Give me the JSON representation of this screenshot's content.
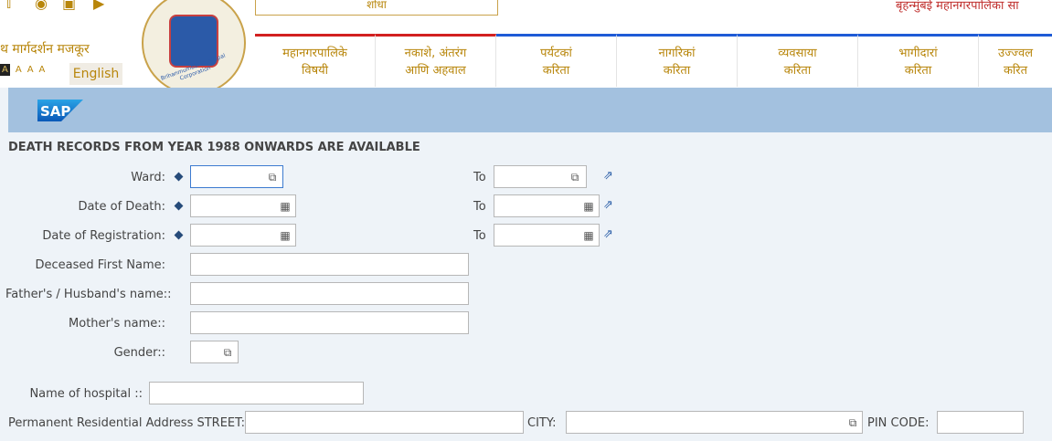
{
  "header": {
    "nav_links": "थ मार्गदर्शन   मजकूर",
    "font_sizes": [
      "A",
      "A",
      "A",
      "A"
    ],
    "english_label": "English",
    "search_label": "शोधा",
    "corp_name": "बृहन्मुंबई महानगरपालिका सा",
    "logo_text": "Brihanmumbai Municipal Corporation",
    "menu": [
      {
        "line1": "महानगरपालिके",
        "line2": "विषयी"
      },
      {
        "line1": "नकाशे, अंतरंग",
        "line2": "आणि अहवाल"
      },
      {
        "line1": "पर्यटकां",
        "line2": "करिता"
      },
      {
        "line1": "नागरिकां",
        "line2": "करिता"
      },
      {
        "line1": "व्यवसाया",
        "line2": "करिता"
      },
      {
        "line1": "भागीदारां",
        "line2": "करिता"
      },
      {
        "line1": "उज्ज्वल",
        "line2": "करित"
      }
    ]
  },
  "sap": {
    "logo_text": "SAP"
  },
  "form": {
    "title": "DEATH RECORDS FROM YEAR 1988 ONWARDS ARE AVAILABLE",
    "to_label": "To",
    "ward_label": "Ward:",
    "date_of_death_label": "Date of Death:",
    "date_of_registration_label": "Date of Registration:",
    "deceased_first_name_label": "Deceased First Name:",
    "father_husband_label": "Father's / Husband's name::",
    "mother_label": "Mother's name::",
    "gender_label": "Gender::",
    "hospital_label": "Name of hospital ::",
    "street_label": "Permanent Residential Address STREET:",
    "city_label": "CITY:",
    "pin_label": "PIN CODE:"
  },
  "colors": {
    "accent_blue": "#1e5bd6",
    "brand_gold": "#b8860b",
    "sap_bar": "#a3c1df",
    "red": "#d22020"
  }
}
